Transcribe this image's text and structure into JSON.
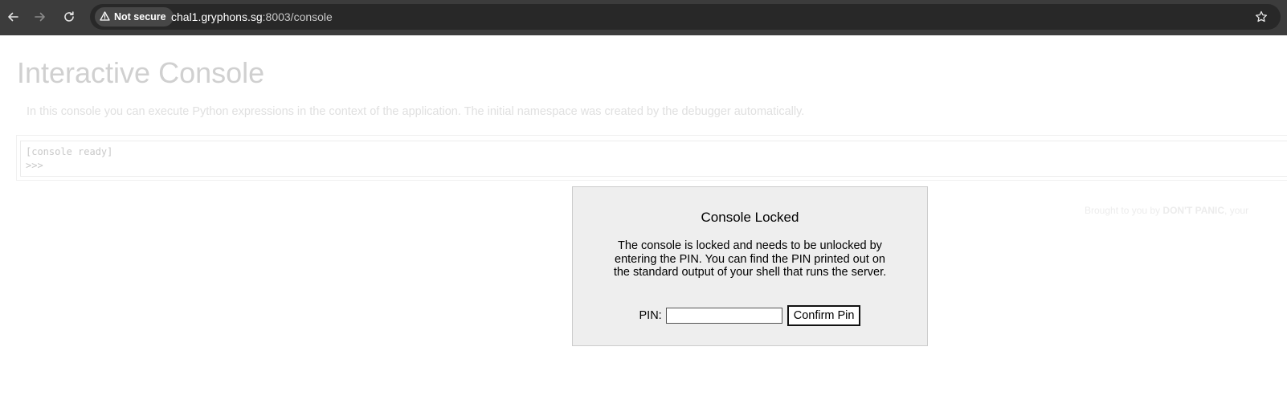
{
  "browser": {
    "security_label": "Not secure",
    "url_host": "chal1.gryphons.sg",
    "url_path": ":8003/console",
    "icons": [
      "back-arrow-icon",
      "forward-arrow-icon",
      "reload-icon",
      "warning-triangle-icon",
      "bookmark-star-icon"
    ]
  },
  "page": {
    "title": "Interactive Console",
    "intro": "In this console you can execute Python expressions in the context of the application. The initial namespace was created by the debugger automatically.",
    "console_ready": "[console ready]",
    "prompt": ">>>",
    "footer_prefix": "Brought to you by ",
    "footer_bold": "DON'T PANIC",
    "footer_suffix": ", your"
  },
  "lock_dialog": {
    "title": "Console Locked",
    "message": "The console is locked and needs to be unlocked by entering the PIN. You can find the PIN printed out on the standard output of your shell that runs the server.",
    "pin_label": "PIN:",
    "pin_value": "",
    "confirm_label": "Confirm Pin"
  }
}
